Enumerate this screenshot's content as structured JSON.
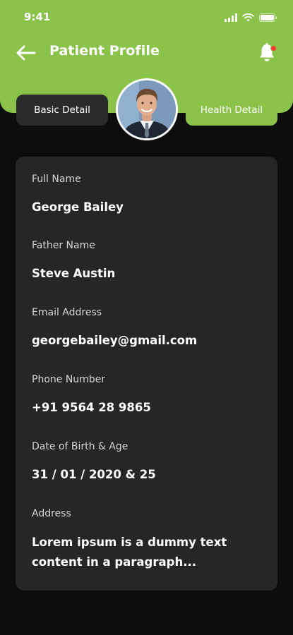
{
  "status_bar": {
    "time": "9:41"
  },
  "header": {
    "title": "Patient Profile",
    "back_icon": "arrow-left-icon",
    "notification_icon": "bell-icon",
    "accent_color": "#8bc34a",
    "badge_color": "#ff3b30"
  },
  "tabs": {
    "basic": "Basic Detail",
    "health": "Health Detail"
  },
  "profile": {
    "avatar": "patient-avatar"
  },
  "details": {
    "full_name_label": "Full Name",
    "full_name": "George Bailey",
    "father_name_label": "Father Name",
    "father_name": "Steve Austin",
    "email_label": "Email Address",
    "email": "georgebailey@gmail.com",
    "phone_label": "Phone Number",
    "phone": "+91 9564 28 9865",
    "dob_label": "Date of Birth & Age",
    "dob_age": "31 / 01 / 2020 & 25",
    "address_label": "Address",
    "address": "Lorem ipsum is a dummy text content in a paragraph..."
  }
}
